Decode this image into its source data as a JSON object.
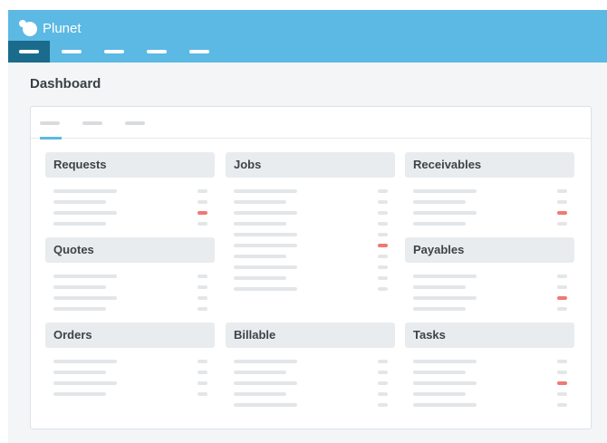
{
  "brand": {
    "name": "Plunet"
  },
  "nav": {
    "item_count": 5,
    "active_index": 0
  },
  "page": {
    "title": "Dashboard"
  },
  "tabs": {
    "count": 3,
    "active_index": 0
  },
  "colors": {
    "header": "#5bb9e3",
    "nav_active": "#1b6b8c",
    "tab_accent": "#5bb9e3",
    "alert": "#ee7a74"
  },
  "panels": [
    {
      "key": "requests",
      "title": "Requests",
      "rows": [
        false,
        false,
        true,
        false
      ]
    },
    {
      "key": "jobs",
      "title": "Jobs",
      "rows": [
        false,
        false,
        false,
        false,
        false,
        true,
        false,
        false,
        false,
        false
      ]
    },
    {
      "key": "receivables",
      "title": "Receivables",
      "rows": [
        false,
        false,
        true,
        false
      ]
    },
    {
      "key": "quotes",
      "title": "Quotes",
      "rows": [
        false,
        false,
        false,
        false
      ]
    },
    {
      "key": "payables",
      "title": "Payables",
      "rows": [
        false,
        false,
        true,
        false
      ]
    },
    {
      "key": "orders",
      "title": "Orders",
      "rows": [
        false,
        false,
        false,
        false
      ]
    },
    {
      "key": "billable",
      "title": "Billable",
      "rows": [
        false,
        false,
        false,
        false,
        false
      ]
    },
    {
      "key": "tasks",
      "title": "Tasks",
      "rows": [
        false,
        false,
        true,
        false,
        false
      ]
    }
  ]
}
